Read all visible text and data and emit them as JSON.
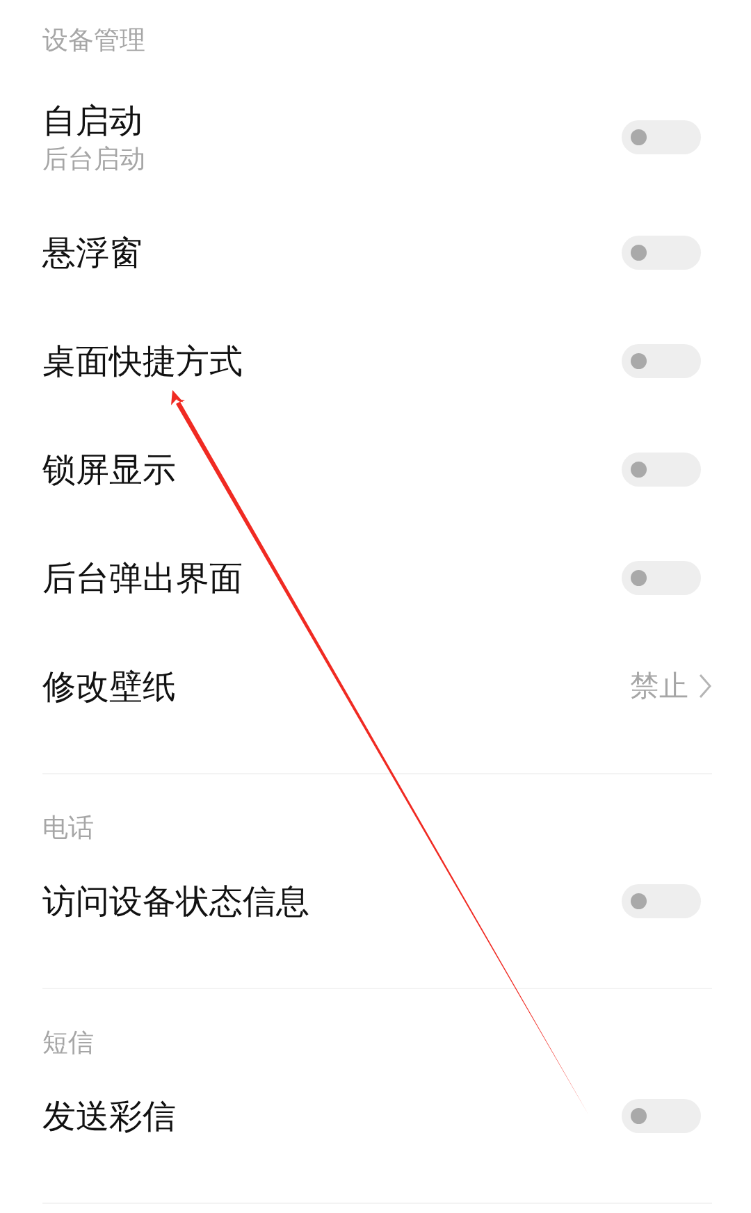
{
  "sections": [
    {
      "title": "设备管理",
      "items": [
        {
          "kind": "toggle",
          "label": "自启动",
          "subtitle": "后台启动",
          "on": false
        },
        {
          "kind": "toggle",
          "label": "悬浮窗",
          "on": false
        },
        {
          "kind": "toggle",
          "label": "桌面快捷方式",
          "on": false
        },
        {
          "kind": "toggle",
          "label": "锁屏显示",
          "on": false
        },
        {
          "kind": "toggle",
          "label": "后台弹出界面",
          "on": false
        },
        {
          "kind": "value",
          "label": "修改壁纸",
          "value": "禁止"
        }
      ]
    },
    {
      "title": "电话",
      "items": [
        {
          "kind": "toggle",
          "label": "访问设备状态信息",
          "on": false
        }
      ]
    },
    {
      "title": "短信",
      "items": [
        {
          "kind": "toggle",
          "label": "发送彩信",
          "on": false
        }
      ]
    }
  ],
  "annotation": {
    "kind": "arrow"
  }
}
